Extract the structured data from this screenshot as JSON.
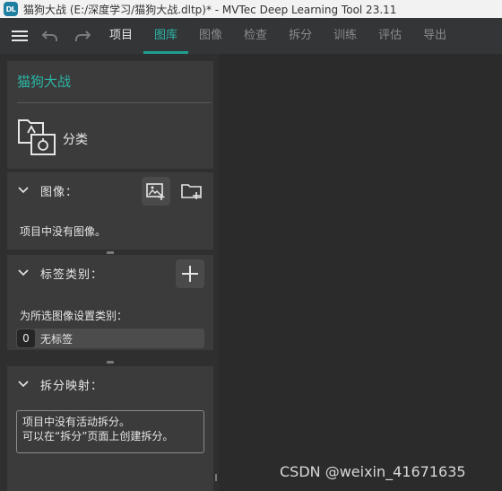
{
  "window": {
    "logo_text": "DL",
    "title": "猫狗大战 (E:/深度学习/猫狗大战.dltp)* - MVTec Deep Learning Tool 23.11"
  },
  "menubar": {
    "tabs": [
      {
        "label": "项目",
        "state": "enabled"
      },
      {
        "label": "图库",
        "state": "active"
      },
      {
        "label": "图像",
        "state": "disabled"
      },
      {
        "label": "检查",
        "state": "disabled"
      },
      {
        "label": "拆分",
        "state": "disabled"
      },
      {
        "label": "训练",
        "state": "disabled"
      },
      {
        "label": "评估",
        "state": "disabled"
      },
      {
        "label": "导出",
        "state": "disabled"
      }
    ],
    "icons": [
      "menu-icon",
      "undo-icon",
      "redo-icon"
    ]
  },
  "project": {
    "name": "猫狗大战",
    "type_label": "分类",
    "type_icon": "classification-icon"
  },
  "images_section": {
    "title": "图像：",
    "empty_text": "项目中没有图像。",
    "icons": [
      "add-image-icon",
      "add-folder-icon"
    ]
  },
  "labels_section": {
    "title": "标签类别：",
    "set_label_text": "为所选图像设置类别：",
    "label_count": "0",
    "label_name": "无标签",
    "icons": [
      "add-label-icon"
    ]
  },
  "split_section": {
    "title": "拆分映射：",
    "info_line1": "项目中没有活动拆分。",
    "info_line2": "可以在“拆分”页面上创建拆分。"
  },
  "watermark": "CSDN @weixin_41671635",
  "colors": {
    "accent": "#2bb5a5",
    "accent_underline": "#1fa091",
    "panel": "#3b3b3b",
    "background": "#2b2b2b",
    "menubar": "#333537"
  }
}
